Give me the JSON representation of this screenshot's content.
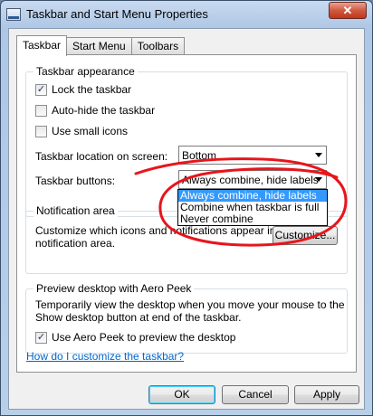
{
  "window": {
    "title": "Taskbar and Start Menu Properties",
    "close_label": "✕"
  },
  "tabs": [
    {
      "label": "Taskbar",
      "active": true
    },
    {
      "label": "Start Menu",
      "active": false
    },
    {
      "label": "Toolbars",
      "active": false
    }
  ],
  "appearance": {
    "group_label": "Taskbar appearance",
    "lock": {
      "label": "Lock the taskbar",
      "checked": true,
      "mark": "✓"
    },
    "autohide": {
      "label": "Auto-hide the taskbar",
      "checked": false,
      "mark": ""
    },
    "small_icons": {
      "label": "Use small icons",
      "checked": false,
      "mark": ""
    },
    "location_label": "Taskbar location on screen:",
    "location_value": "Bottom",
    "buttons_label": "Taskbar buttons:",
    "buttons_value": "Always combine, hide labels",
    "buttons_options": [
      {
        "label": "Always combine, hide labels",
        "selected": true
      },
      {
        "label": "Combine when taskbar is full",
        "selected": false
      },
      {
        "label": "Never combine",
        "selected": false
      }
    ]
  },
  "notification": {
    "group_label": "Notification area",
    "description_line1": "Customize which icons and notifications appear in the",
    "description_line2": "notification area.",
    "customize_label": "Customize..."
  },
  "aero_peek": {
    "group_label": "Preview desktop with Aero Peek",
    "description_line1": "Temporarily view the desktop when you move your mouse to the",
    "description_line2": "Show desktop button at end of the taskbar.",
    "checkbox": {
      "label": "Use Aero Peek to preview the desktop",
      "checked": true,
      "mark": "✓"
    }
  },
  "help_link": "How do I customize the taskbar?",
  "footer": {
    "ok_label": "OK",
    "cancel_label": "Cancel",
    "apply_label": "Apply"
  },
  "colors": {
    "annotation": "#e8151b",
    "selection": "#3399ff",
    "link": "#0066cc"
  }
}
